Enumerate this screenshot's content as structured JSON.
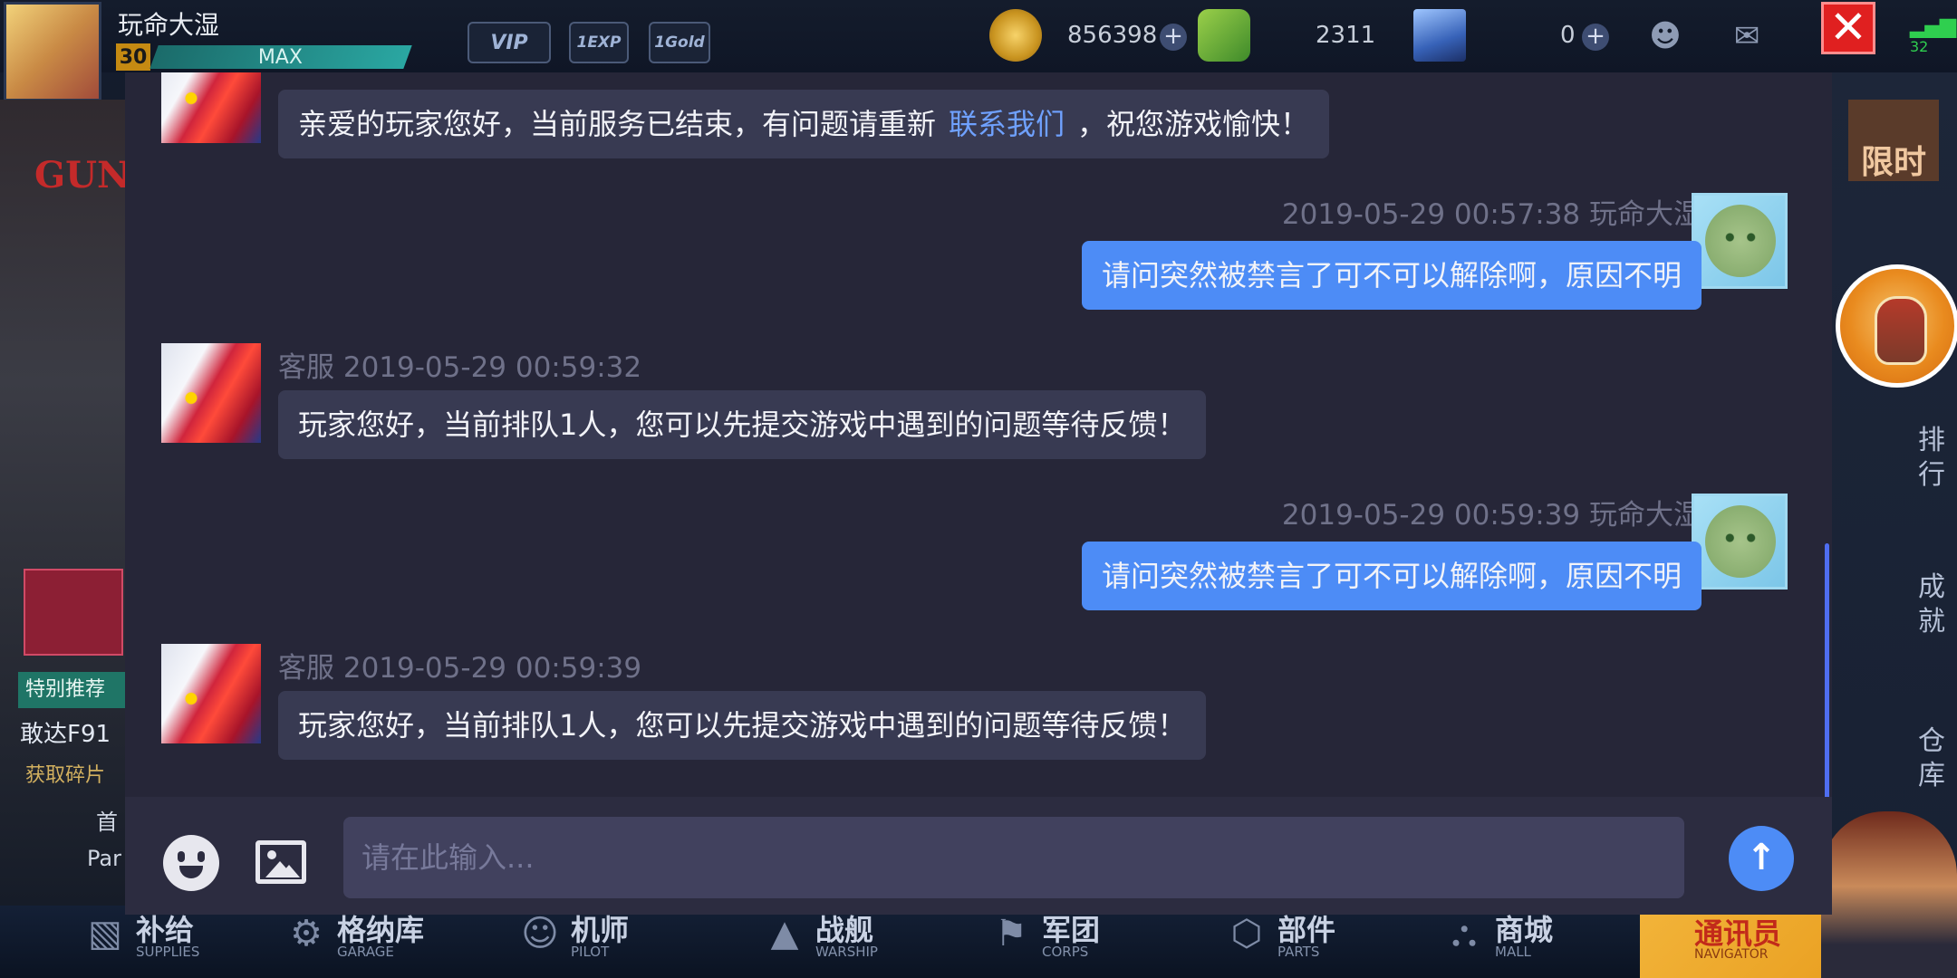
{
  "topbar": {
    "player_name": "玩命大湿",
    "level": "30",
    "xp_label": "MAX",
    "vip_label": "VIP",
    "exp_badge": "1EXP",
    "gold_badge": "1Gold",
    "gold_amount": "856398",
    "gem_amount": "2311",
    "crystal_amount": "0",
    "signal": "32",
    "icons": [
      "friends-icon",
      "mail-icon",
      "close-icon"
    ]
  },
  "left_side": {
    "promo_label": "特别推荐",
    "promo_name": "敢达F91",
    "promo_sub": "获取碎片",
    "mini_item_1": "首",
    "mini_item_2": "Par"
  },
  "right_side": {
    "limited": "限时",
    "tab_rank": "排行",
    "tab_achievement": "成就",
    "tab_warehouse": "仓库"
  },
  "chat": {
    "messages": [
      {
        "sender": "service",
        "meta": "",
        "text_before": "亲爱的玩家您好，当前服务已结束，有问题请重新",
        "link": "联系我们",
        "text_after": "，祝您游戏愉快！"
      },
      {
        "sender": "user",
        "meta": "2019-05-29 00:57:38  玩命大湿",
        "text": "请问突然被禁言了可不可以解除啊，原因不明"
      },
      {
        "sender": "service",
        "meta": "客服  2019-05-29 00:59:32",
        "text": "玩家您好，当前排队1人，您可以先提交游戏中遇到的问题等待反馈！"
      },
      {
        "sender": "user",
        "meta": "2019-05-29 00:59:39  玩命大湿",
        "text": "请问突然被禁言了可不可以解除啊，原因不明"
      },
      {
        "sender": "service",
        "meta": "客服  2019-05-29 00:59:39",
        "text": "玩家您好，当前排队1人，您可以先提交游戏中遇到的问题等待反馈！"
      }
    ],
    "input": {
      "placeholder": "请在此输入...",
      "value": ""
    }
  },
  "bottom_nav": [
    {
      "cn": "补给",
      "en": "SUPPLIES",
      "icon": "supplies-icon"
    },
    {
      "cn": "格纳库",
      "en": "GARAGE",
      "icon": "garage-icon"
    },
    {
      "cn": "机师",
      "en": "PILOT",
      "icon": "pilot-icon"
    },
    {
      "cn": "战舰",
      "en": "WARSHIP",
      "icon": "warship-icon"
    },
    {
      "cn": "军团",
      "en": "CORPS",
      "icon": "corps-icon"
    },
    {
      "cn": "部件",
      "en": "PARTS",
      "icon": "parts-icon"
    },
    {
      "cn": "商城",
      "en": "MALL",
      "icon": "mall-icon"
    }
  ],
  "navigator": {
    "cn": "通讯员",
    "en": "NAVIGATOR"
  },
  "colors": {
    "panel_bg": "#262638",
    "service_bubble": "#383a52",
    "user_bubble": "#4d8cf6",
    "link": "#6fa1ff",
    "close_red": "#e02020"
  }
}
